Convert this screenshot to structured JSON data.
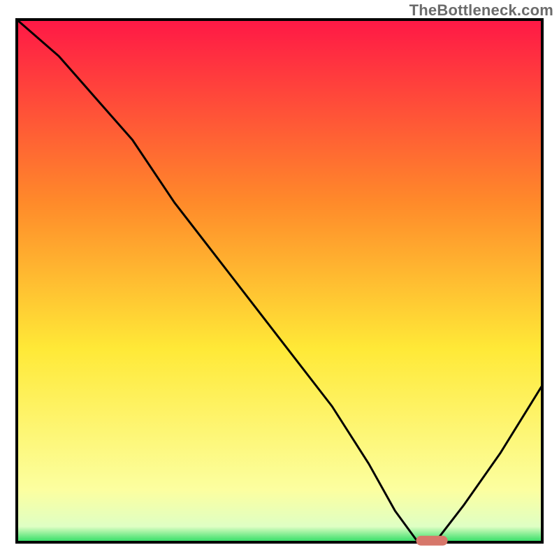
{
  "watermark": "TheBottleneck.com",
  "chart_data": {
    "type": "line",
    "title": "",
    "xlabel": "",
    "ylabel": "",
    "xlim": [
      0,
      100
    ],
    "ylim": [
      0,
      100
    ],
    "background_gradient": {
      "top": "#FF1846",
      "mid1": "#FF8A2A",
      "mid2": "#FFE937",
      "mid3": "#FCFFA0",
      "bottom": "#2BDC62"
    },
    "series": [
      {
        "name": "bottleneck-curve",
        "x": [
          0,
          8,
          15,
          22,
          30,
          40,
          50,
          60,
          67,
          72,
          76,
          80,
          85,
          92,
          100
        ],
        "values": [
          100,
          93,
          85,
          77,
          65,
          52,
          39,
          26,
          15,
          6,
          0.5,
          0.5,
          7,
          17,
          30
        ]
      }
    ],
    "marker": {
      "name": "optimal-range",
      "x_start": 76,
      "x_end": 82,
      "y": 0.3,
      "color": "#D7776A"
    },
    "grid": false,
    "legend": false,
    "axes_visible": false
  }
}
